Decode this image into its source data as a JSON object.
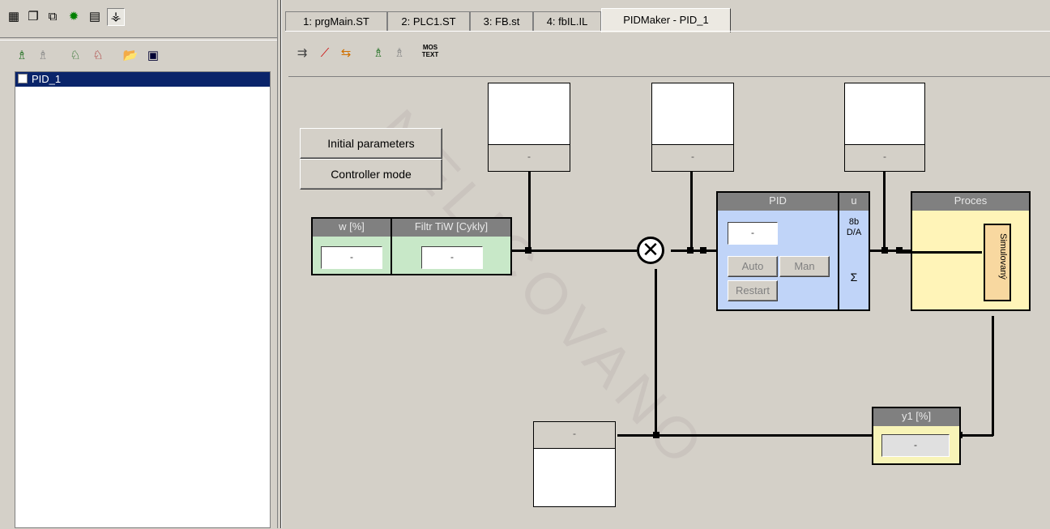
{
  "left_toolbar_top": {
    "icons": [
      "files-icon",
      "copy-icon",
      "pages-icon",
      "bug-icon",
      "library-icon",
      "network-icon"
    ]
  },
  "left_toolbar_bottom": {
    "icons": [
      "run-icon",
      "stop-icon",
      "add-node-icon",
      "remove-node-icon",
      "open-folder-icon",
      "save-icon"
    ]
  },
  "tree": {
    "items": [
      {
        "label": "PID_1",
        "checked": false,
        "selected": true
      }
    ]
  },
  "tabs": [
    {
      "label": "1: prgMain.ST"
    },
    {
      "label": "2: PLC1.ST"
    },
    {
      "label": "3: FB.st"
    },
    {
      "label": "4: fbIL.IL"
    },
    {
      "label": "PIDMaker - PID_1",
      "active": true
    }
  ],
  "pid_toolbar": {
    "icons": [
      "export-icon",
      "chart-icon",
      "refresh-icon",
      "run-icon",
      "stop-icon"
    ],
    "mos_text_line1": "MOS",
    "mos_text_line2": "TEXT"
  },
  "buttons": {
    "initial_parameters": "Initial parameters",
    "controller_mode": "Controller mode"
  },
  "displays": {
    "top_left": "-",
    "top_mid": "-",
    "top_right": "-",
    "bottom": "-"
  },
  "setpoint": {
    "w_header": "w [%]",
    "w_value": "-",
    "filter_header": "Filtr TiW [Cykly]",
    "filter_value": "-"
  },
  "pid": {
    "header": "PID",
    "u_header": "u",
    "output_value": "-",
    "auto": "Auto",
    "man": "Man",
    "restart": "Restart",
    "da_line1": "8b",
    "da_line2": "D/A",
    "sigma": "Σ"
  },
  "process": {
    "header": "Proces",
    "simulated": "Simulovaný"
  },
  "y1": {
    "header": "y1 [%]",
    "value": "-"
  },
  "watermark": "NELICOVANO",
  "colors": {
    "setpoint_bg": "#c8e8c8",
    "pid_bg": "#c0d4f8",
    "process_bg": "#fff4b8",
    "sim_bg": "#f8d8a0",
    "y1_bg": "#f8f4b8",
    "selection": "#0a246a"
  }
}
